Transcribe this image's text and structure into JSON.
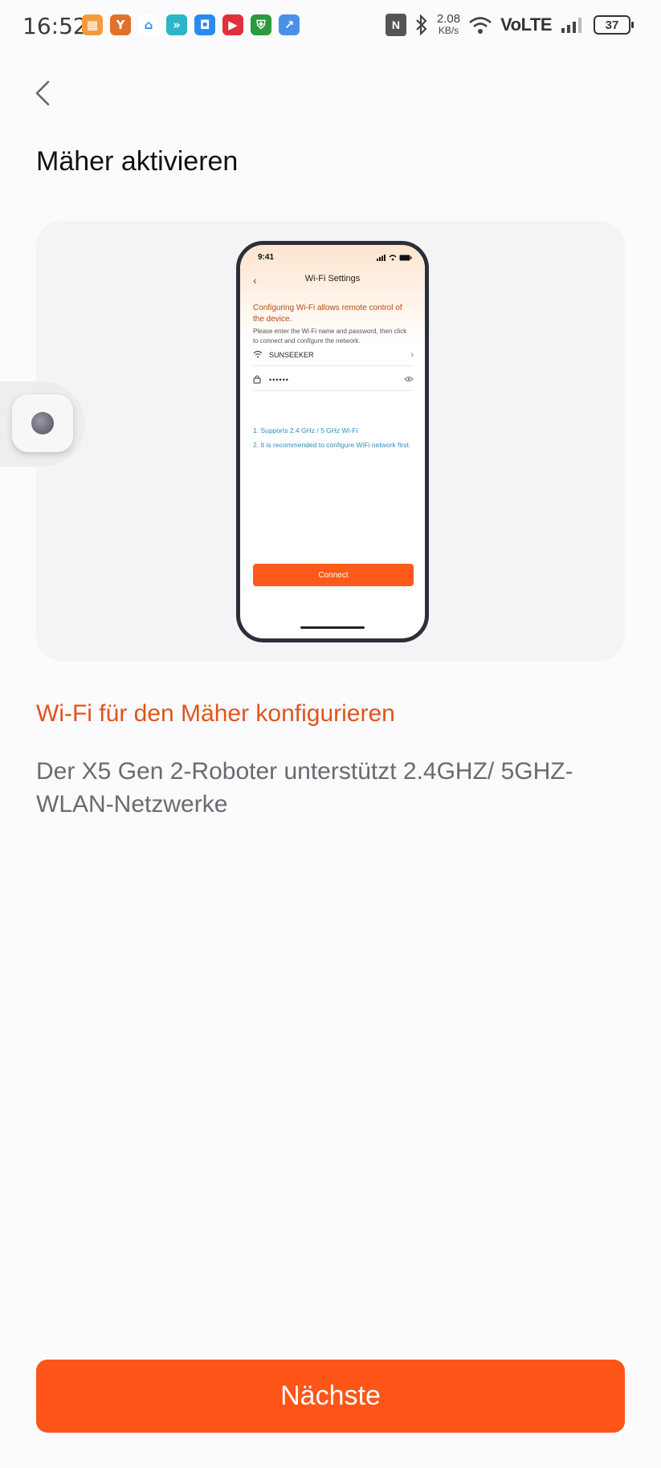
{
  "status_bar": {
    "time": "16:52",
    "net_speed_value": "2.08",
    "net_speed_unit": "KB/s",
    "network": "VoLTE",
    "battery": "37",
    "app_icons": [
      "grid-app-icon",
      "fox-app-icon",
      "home-app-icon",
      "arrow-app-icon",
      "shield-app-icon",
      "play-app-icon",
      "security-app-icon",
      "trend-app-icon"
    ]
  },
  "header": {
    "title": "Mäher aktivieren"
  },
  "illustration": {
    "time": "9:41",
    "screen_title": "Wi-Fi Settings",
    "heading": "Configuring Wi-Fi allows remote control of the device.",
    "description": "Please enter the Wi-Fi name and password, then click to connect and configure the network.",
    "wifi_name": "SUNSEEKER",
    "password_mask": "••••••",
    "notes": [
      "1. Supports 2.4 GHz / 5 GHz Wi-Fi",
      "2. It is recommended to configure WiFi network first."
    ],
    "connect_label": "Connect"
  },
  "main": {
    "subtitle": "Wi-Fi für den Mäher konfigurieren",
    "description": "Der X5 Gen 2-Roboter unterstützt 2.4GHZ/ 5GHZ-WLAN-Netzwerke"
  },
  "footer": {
    "next_label": "Nächste"
  },
  "colors": {
    "accent": "#ff5518",
    "subtitle": "#e0541c",
    "card_bg": "#f4f4f6"
  }
}
